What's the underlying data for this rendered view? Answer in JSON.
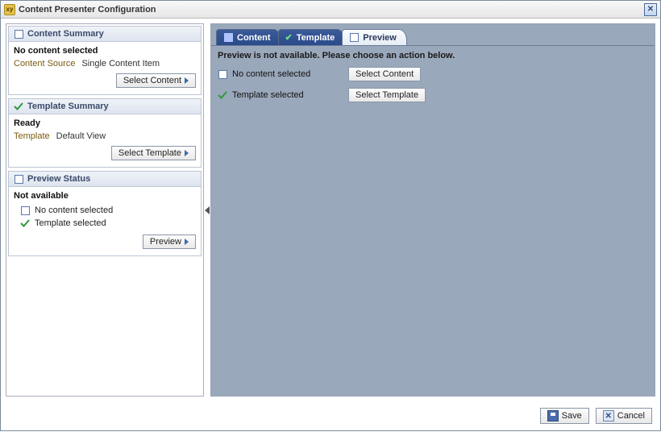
{
  "dialog": {
    "title": "Content Presenter Configuration"
  },
  "sidebar": {
    "content_summary": {
      "header": "Content Summary",
      "status": "No content selected",
      "source_label": "Content Source",
      "source_value": "Single Content Item",
      "select_btn": "Select Content"
    },
    "template_summary": {
      "header": "Template Summary",
      "status": "Ready",
      "template_label": "Template",
      "template_value": "Default View",
      "select_btn": "Select Template"
    },
    "preview_status": {
      "header": "Preview Status",
      "status": "Not available",
      "items": [
        {
          "ok": false,
          "label": "No content selected"
        },
        {
          "ok": true,
          "label": "Template selected"
        }
      ],
      "preview_btn": "Preview"
    }
  },
  "tabs": {
    "content": "Content",
    "template": "Template",
    "preview": "Preview"
  },
  "main": {
    "message": "Preview is not available. Please choose an action below.",
    "rows": [
      {
        "ok": false,
        "label": "No content selected",
        "button": "Select Content"
      },
      {
        "ok": true,
        "label": "Template selected",
        "button": "Select Template"
      }
    ]
  },
  "footer": {
    "save": "Save",
    "cancel": "Cancel"
  }
}
